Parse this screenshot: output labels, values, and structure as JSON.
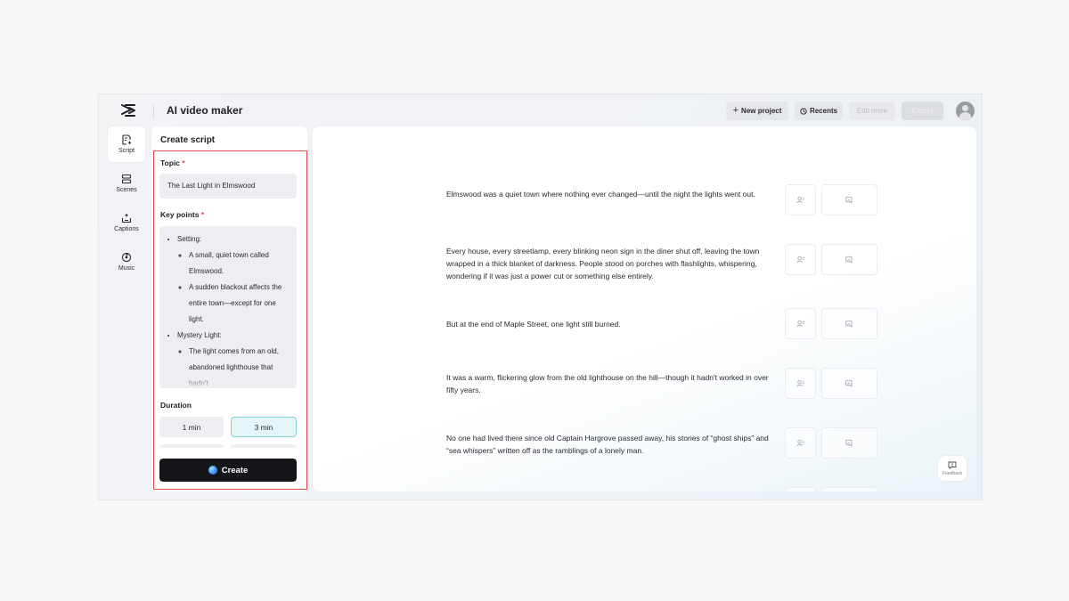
{
  "app": {
    "title": "AI video maker",
    "logo": "capcut-logo-icon"
  },
  "toolbar": {
    "new_project": "New project",
    "recents": "Recents",
    "edit_more": "Edit more",
    "export": "Export"
  },
  "rail": {
    "items": [
      {
        "label": "Script",
        "icon": "script-icon",
        "active": true
      },
      {
        "label": "Scenes",
        "icon": "scenes-icon",
        "active": false
      },
      {
        "label": "Captions",
        "icon": "captions-icon",
        "active": false
      },
      {
        "label": "Music",
        "icon": "music-icon",
        "active": false
      }
    ]
  },
  "panel": {
    "title": "Create script",
    "topic_label": "Topic",
    "topic_value": "The Last Light in Elmswood",
    "keypoints_label": "Key points",
    "required_mark": "*",
    "keypoints": {
      "setting": "Setting:",
      "setting_1": "A small, quiet town called Elmswood.",
      "setting_2": "A sudden blackout affects the entire town—except for one light.",
      "mystery": "Mystery Light:",
      "mystery_1": "The light comes from an old, abandoned lighthouse that hadn't"
    },
    "duration_label": "Duration",
    "durations": [
      "1 min",
      "3 min"
    ],
    "selected_duration": "3 min",
    "create_label": "Create"
  },
  "script": {
    "paragraphs": [
      "Elmswood was a quiet town where nothing ever changed—until the night the lights went out.",
      "Every house, every streetlamp, every blinking neon sign in the diner shut off, leaving the town wrapped in a thick blanket of darkness. People stood on porches with flashlights, whispering, wondering if it was just a power cut or something else entirely.",
      "But at the end of Maple Street, one light still burned.",
      "It was a warm, flickering glow from the old lighthouse on the hill—though it hadn't worked in over fifty years.",
      "No one had lived there since old Captain Hargrove passed away, his stories of “ghost ships” and “sea whispers” written off as the ramblings of a lonely man."
    ]
  },
  "feedback": {
    "label": "Feedback"
  },
  "colors": {
    "accent_red": "#e04848",
    "selected_cyan": "#7fd3dc",
    "create_bg": "#15161a"
  }
}
